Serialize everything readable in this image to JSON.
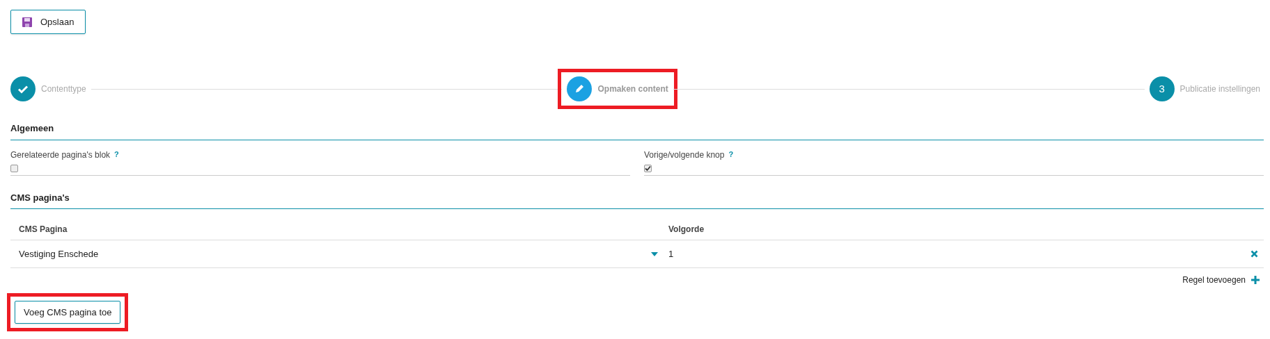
{
  "toolbar": {
    "save_button": "Opslaan"
  },
  "steps": [
    {
      "kind": "done",
      "label": "Contenttype",
      "highlighted": false
    },
    {
      "kind": "active",
      "label": "Opmaken content",
      "highlighted": true
    },
    {
      "kind": "todo",
      "number": "3",
      "label": "Publicatie instellingen",
      "highlighted": false
    }
  ],
  "sections": [
    {
      "title": "Algemeen",
      "fields": [
        {
          "label": "Gerelateerde pagina's blok",
          "help": "?",
          "checked": false
        },
        {
          "label": "Vorige/volgende knop",
          "help": "?",
          "checked": true
        }
      ]
    },
    {
      "title": "CMS pagina's",
      "table": {
        "columns": [
          "CMS Pagina",
          "Volgorde"
        ],
        "rows": [
          {
            "page": "Vestiging Enschede",
            "order": "1"
          }
        ],
        "add_row": "Regel toevoegen"
      }
    }
  ],
  "add_button": {
    "label": "Voeg CMS pagina toe",
    "highlighted": true
  }
}
